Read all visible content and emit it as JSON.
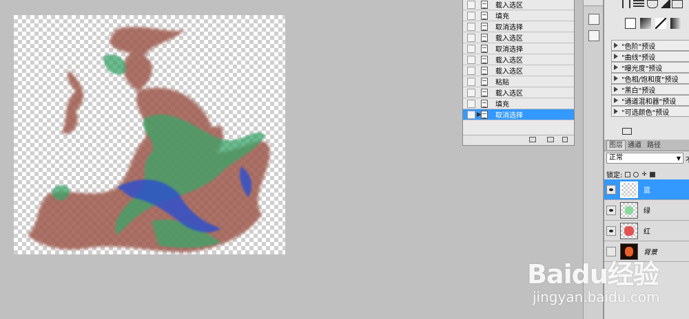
{
  "history": {
    "items": [
      {
        "label": "载入选区",
        "selected": false
      },
      {
        "label": "填充",
        "selected": false
      },
      {
        "label": "取消选择",
        "selected": false
      },
      {
        "label": "载入选区",
        "selected": false
      },
      {
        "label": "取消选择",
        "selected": false
      },
      {
        "label": "载入选区",
        "selected": false
      },
      {
        "label": "载入选区",
        "selected": false
      },
      {
        "label": "粘贴",
        "selected": false
      },
      {
        "label": "载入选区",
        "selected": false
      },
      {
        "label": "填充",
        "selected": false
      },
      {
        "label": "取消选择",
        "selected": true
      }
    ]
  },
  "adjustments": {
    "presets": [
      "\"色阶\"预设",
      "\"曲线\"预设",
      "\"曝光度\"预设",
      "\"色相/饱和度\"预设",
      "\"黑白\"预设",
      "\"通道混和器\"预设",
      "\"可选颜色\"预设"
    ]
  },
  "layers_panel": {
    "tabs": [
      "图层",
      "通道",
      "路径"
    ],
    "blend_mode": "正常",
    "opacity_label": "不",
    "lock_label": "锁定:",
    "layers": [
      {
        "name": "蓝",
        "visible": true,
        "selected": true
      },
      {
        "name": "绿",
        "visible": true,
        "selected": false
      },
      {
        "name": "红",
        "visible": true,
        "selected": false
      },
      {
        "name": "背景",
        "visible": false,
        "selected": false
      }
    ]
  },
  "watermark": {
    "logo": "Baidu经验",
    "url": "jingyan.baidu.com"
  },
  "colors": {
    "selection": "#3399ff",
    "canvas_bg": "#c0c0c0",
    "smoke_red": "#9e5a4e",
    "smoke_green": "#3aa56a",
    "smoke_blue": "#2a4fd0"
  }
}
